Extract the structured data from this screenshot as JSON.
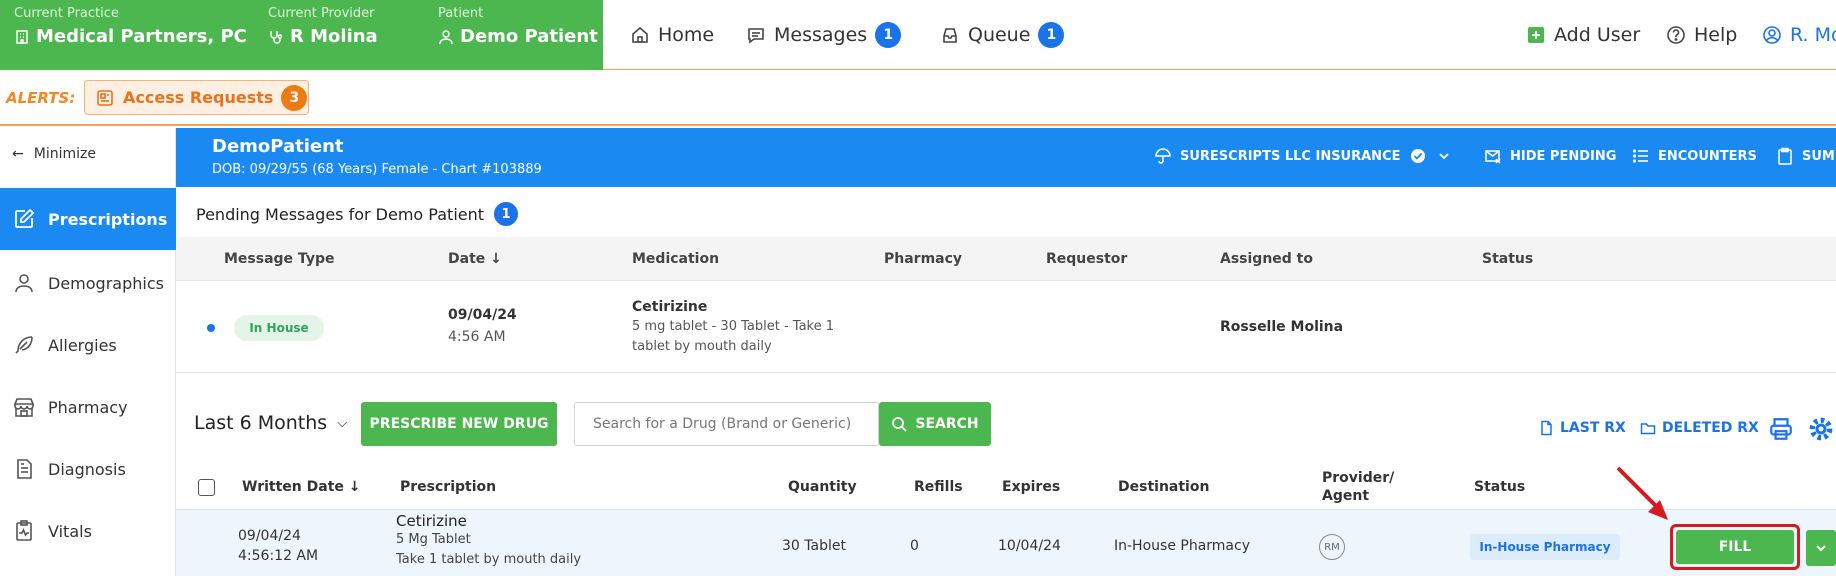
{
  "context": {
    "practice_label": "Current Practice",
    "practice_value": "Medical Partners, PC",
    "provider_label": "Current Provider",
    "provider_value": "R Molina",
    "patient_label": "Patient",
    "patient_value": "Demo Patient"
  },
  "nav": {
    "home": "Home",
    "messages": "Messages",
    "messages_count": "1",
    "queue": "Queue",
    "queue_count": "1",
    "add_user": "Add User",
    "help": "Help",
    "user": "R. Mo"
  },
  "alerts": {
    "title": "ALERTS:",
    "access_requests": "Access Requests",
    "access_requests_count": "3"
  },
  "sidebar": {
    "minimize": "Minimize",
    "items": [
      "Prescriptions",
      "Demographics",
      "Allergies",
      "Pharmacy",
      "Diagnosis",
      "Vitals"
    ]
  },
  "patient_header": {
    "name": "DemoPatient",
    "details": "DOB: 09/29/55 (68 Years) Female - Chart #103889",
    "insurance": "SURESCRIPTS LLC INSURANCE",
    "hide_pending": "HIDE PENDING",
    "encounters": "ENCOUNTERS",
    "summary": "SUMM"
  },
  "pending": {
    "title": "Pending Messages for Demo Patient",
    "count": "1",
    "columns": [
      "Message Type",
      "Date",
      "Medication",
      "Pharmacy",
      "Requestor",
      "Assigned to",
      "Status"
    ],
    "row": {
      "type": "In House",
      "date": "09/04/24",
      "time": "4:56 AM",
      "med_name": "Cetirizine",
      "med_line1": "5 mg tablet - 30 Tablet - Take 1",
      "med_line2": "tablet by mouth daily",
      "assigned": "Rosselle Molina"
    }
  },
  "rx_toolbar": {
    "period": "Last 6 Months",
    "prescribe": "PRESCRIBE NEW DRUG",
    "search_placeholder": "Search for a Drug (Brand or Generic)",
    "search_button": "SEARCH",
    "last_rx": "LAST RX",
    "deleted_rx": "DELETED RX"
  },
  "rx_table": {
    "columns": {
      "written": "Written Date",
      "prescription": "Prescription",
      "quantity": "Quantity",
      "refills": "Refills",
      "expires": "Expires",
      "destination": "Destination",
      "provider_1": "Provider/",
      "provider_2": "Agent",
      "status": "Status"
    },
    "row": {
      "date": "09/04/24",
      "time": "4:56:12 AM",
      "drug": "Cetirizine",
      "strength": "5 Mg Tablet",
      "sig": "Take 1 tablet by mouth daily",
      "quantity": "30 Tablet",
      "refills": "0",
      "expires": "10/04/24",
      "destination": "In-House Pharmacy",
      "provider_initials": "RM",
      "status": "In-House Pharmacy",
      "fill": "FILL"
    }
  },
  "colors": {
    "green": "#4cb74f",
    "blue": "#1a8af2",
    "orange": "#f07a12",
    "highlight_red": "#d71920"
  }
}
